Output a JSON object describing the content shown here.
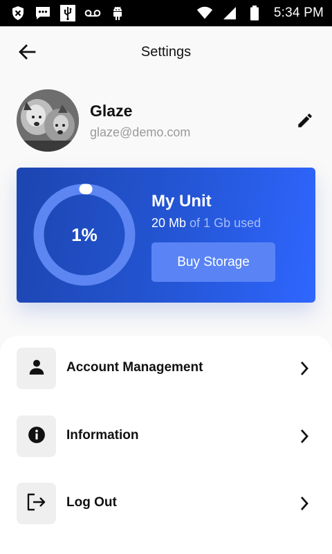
{
  "status_bar": {
    "time": "5:34 PM",
    "left_icons": [
      "shield-x-icon",
      "message-icon",
      "usb-icon",
      "voicemail-icon",
      "android-icon"
    ],
    "right_icons": [
      "wifi-icon",
      "signal-icon",
      "battery-icon"
    ]
  },
  "header": {
    "title": "Settings",
    "back_icon": "arrow-left-icon"
  },
  "profile": {
    "name": "Glaze",
    "email": "glaze@demo.com",
    "edit_icon": "pencil-icon"
  },
  "storage": {
    "percent_label": "1%",
    "percent_value": 0.01,
    "title": "My Unit",
    "used": "20 Mb",
    "of_total": "of 1 Gb used",
    "button_label": "Buy Storage"
  },
  "menu": {
    "items": [
      {
        "label": "Account Management",
        "icon": "person-icon"
      },
      {
        "label": "Information",
        "icon": "info-icon"
      },
      {
        "label": "Log Out",
        "icon": "logout-icon"
      }
    ]
  },
  "colors": {
    "card_gradient_start": "#1c45b0",
    "card_gradient_end": "#2f66ff",
    "button_blue": "#5a84f5",
    "ring_track": "#5d86f2"
  }
}
